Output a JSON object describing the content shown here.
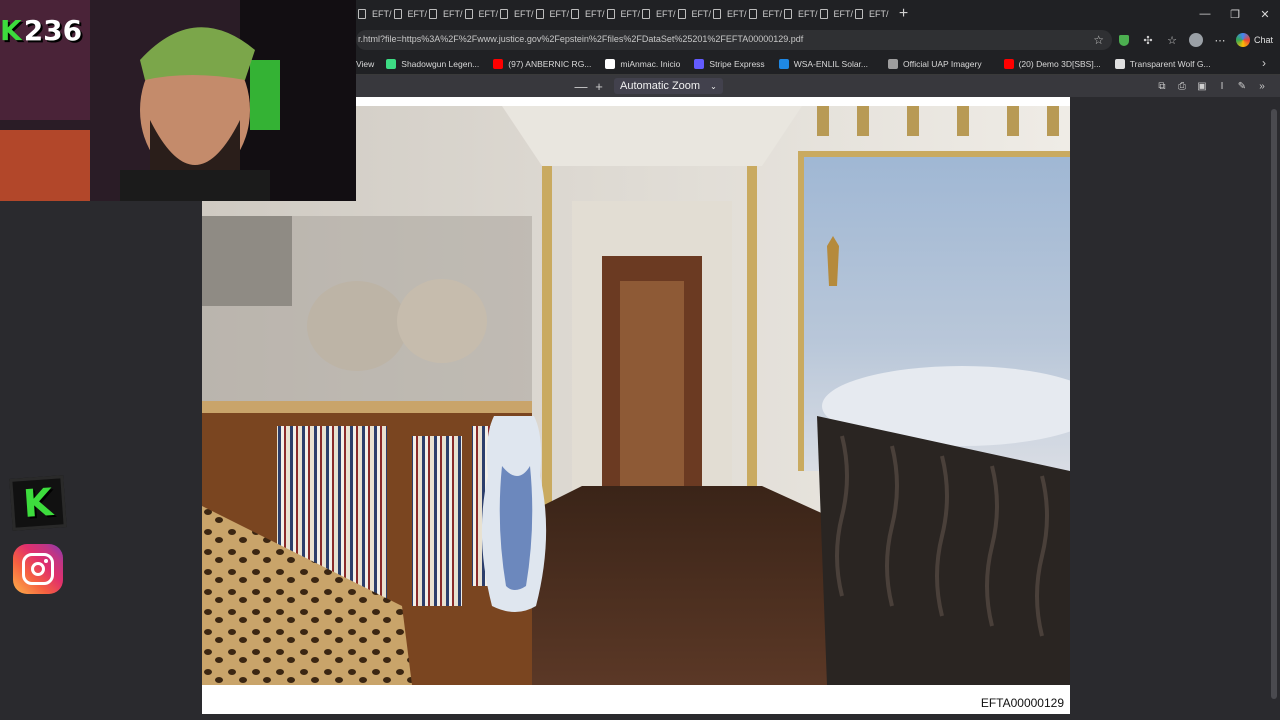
{
  "browser": {
    "tabs": [
      {
        "label": "EFT/"
      },
      {
        "label": "EFT/"
      },
      {
        "label": "EFT/"
      },
      {
        "label": "EFT/"
      },
      {
        "label": "EFT/"
      },
      {
        "label": "EFT/"
      },
      {
        "label": "EFT/"
      },
      {
        "label": "EFT/"
      },
      {
        "label": "EFT/"
      },
      {
        "label": "EFT/"
      },
      {
        "label": "EFT/"
      },
      {
        "label": "EFT/"
      },
      {
        "label": "EFT/"
      },
      {
        "label": "EFT/"
      },
      {
        "label": "EFT/"
      }
    ],
    "new_tab_icon": "+",
    "window_controls": {
      "minimize": "—",
      "restore": "❐",
      "close": "✕"
    },
    "url": "r.html?file=https%3A%2F%2Fwww.justice.gov%2Fepstein%2Ffiles%2FDataSet%25201%2FEFTA00000129.pdf",
    "chat_label": "Chat",
    "bookmarks": [
      {
        "label": "View",
        "icon_color": "#5f6368"
      },
      {
        "label": "Shadowgun Legen...",
        "icon_color": "#3ddc84"
      },
      {
        "label": "(97) ANBERNIC RG...",
        "icon_color": "#ff0000"
      },
      {
        "label": "miAnmac. Inicio",
        "icon_color": "#ffffff"
      },
      {
        "label": "Stripe Express",
        "icon_color": "#635bff"
      },
      {
        "label": "WSA-ENLIL Solar...",
        "icon_color": "#1e88e5"
      },
      {
        "label": "Official UAP Imagery",
        "icon_color": "#9e9e9e"
      },
      {
        "label": "(20) Demo 3D[SBS]...",
        "icon_color": "#ff0000"
      },
      {
        "label": "Transparent Wolf G...",
        "icon_color": "#e0e0e0"
      }
    ]
  },
  "pdf": {
    "zoom_out": "—",
    "zoom_in": "+",
    "zoom_value": "Automatic Zoom",
    "page_label": "EFTA00000129"
  },
  "overlay": {
    "counter": "236",
    "k_logo": "K"
  },
  "colors": {
    "accent_green": "#3ddc3d",
    "viewer_bg": "#2a2a2e",
    "toolbar_bg": "#38383d"
  }
}
